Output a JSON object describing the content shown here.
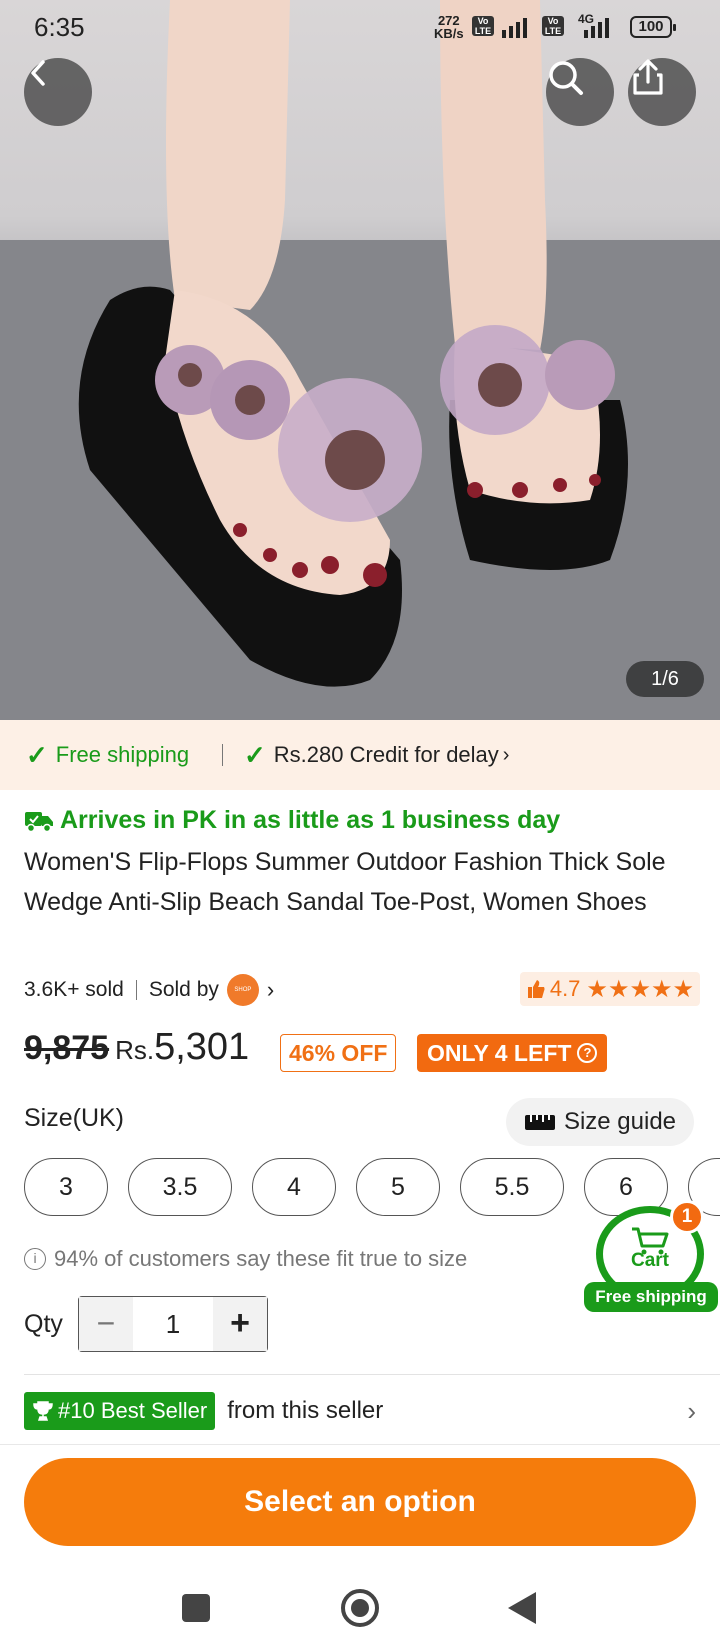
{
  "status_bar": {
    "time": "6:35",
    "net_speed_value": "272",
    "net_speed_unit": "KB/s",
    "lte_label_1": "Vo LTE",
    "lte_label_2": "Vo LTE",
    "network_type": "4G",
    "battery": "100"
  },
  "gallery": {
    "pager": "1/6"
  },
  "shipping": {
    "free_shipping": "Free shipping",
    "credit": "Rs.280 Credit for delay",
    "arrives": "Arrives in PK in as little as 1 business day"
  },
  "product": {
    "title": "Women'S Flip-Flops Summer Outdoor Fashion Thick Sole Wedge Anti-Slip Beach Sandal Toe-Post, Women Shoes",
    "sold": "3.6K+ sold",
    "sold_by": "Sold by",
    "rating": "4.7",
    "stars": "★★★★★",
    "original_price": "9,875",
    "currency": "Rs.",
    "price": "5,301",
    "discount": "46% OFF",
    "stock": "ONLY 4 LEFT"
  },
  "size": {
    "label": "Size(UK)",
    "guide": "Size guide",
    "options": [
      "3",
      "3.5",
      "4",
      "5",
      "5.5",
      "6"
    ],
    "fit_note": "94% of customers say these fit true to size"
  },
  "quantity": {
    "label": "Qty",
    "value": "1"
  },
  "cart": {
    "label": "Cart",
    "count": "1",
    "free_shipping": "Free shipping"
  },
  "seller": {
    "badge": "#10 Best Seller",
    "suffix": "from this seller"
  },
  "cta": {
    "label": "Select an option"
  },
  "colors": {
    "accent_orange": "#f57c0c",
    "green": "#1a9b1a"
  }
}
